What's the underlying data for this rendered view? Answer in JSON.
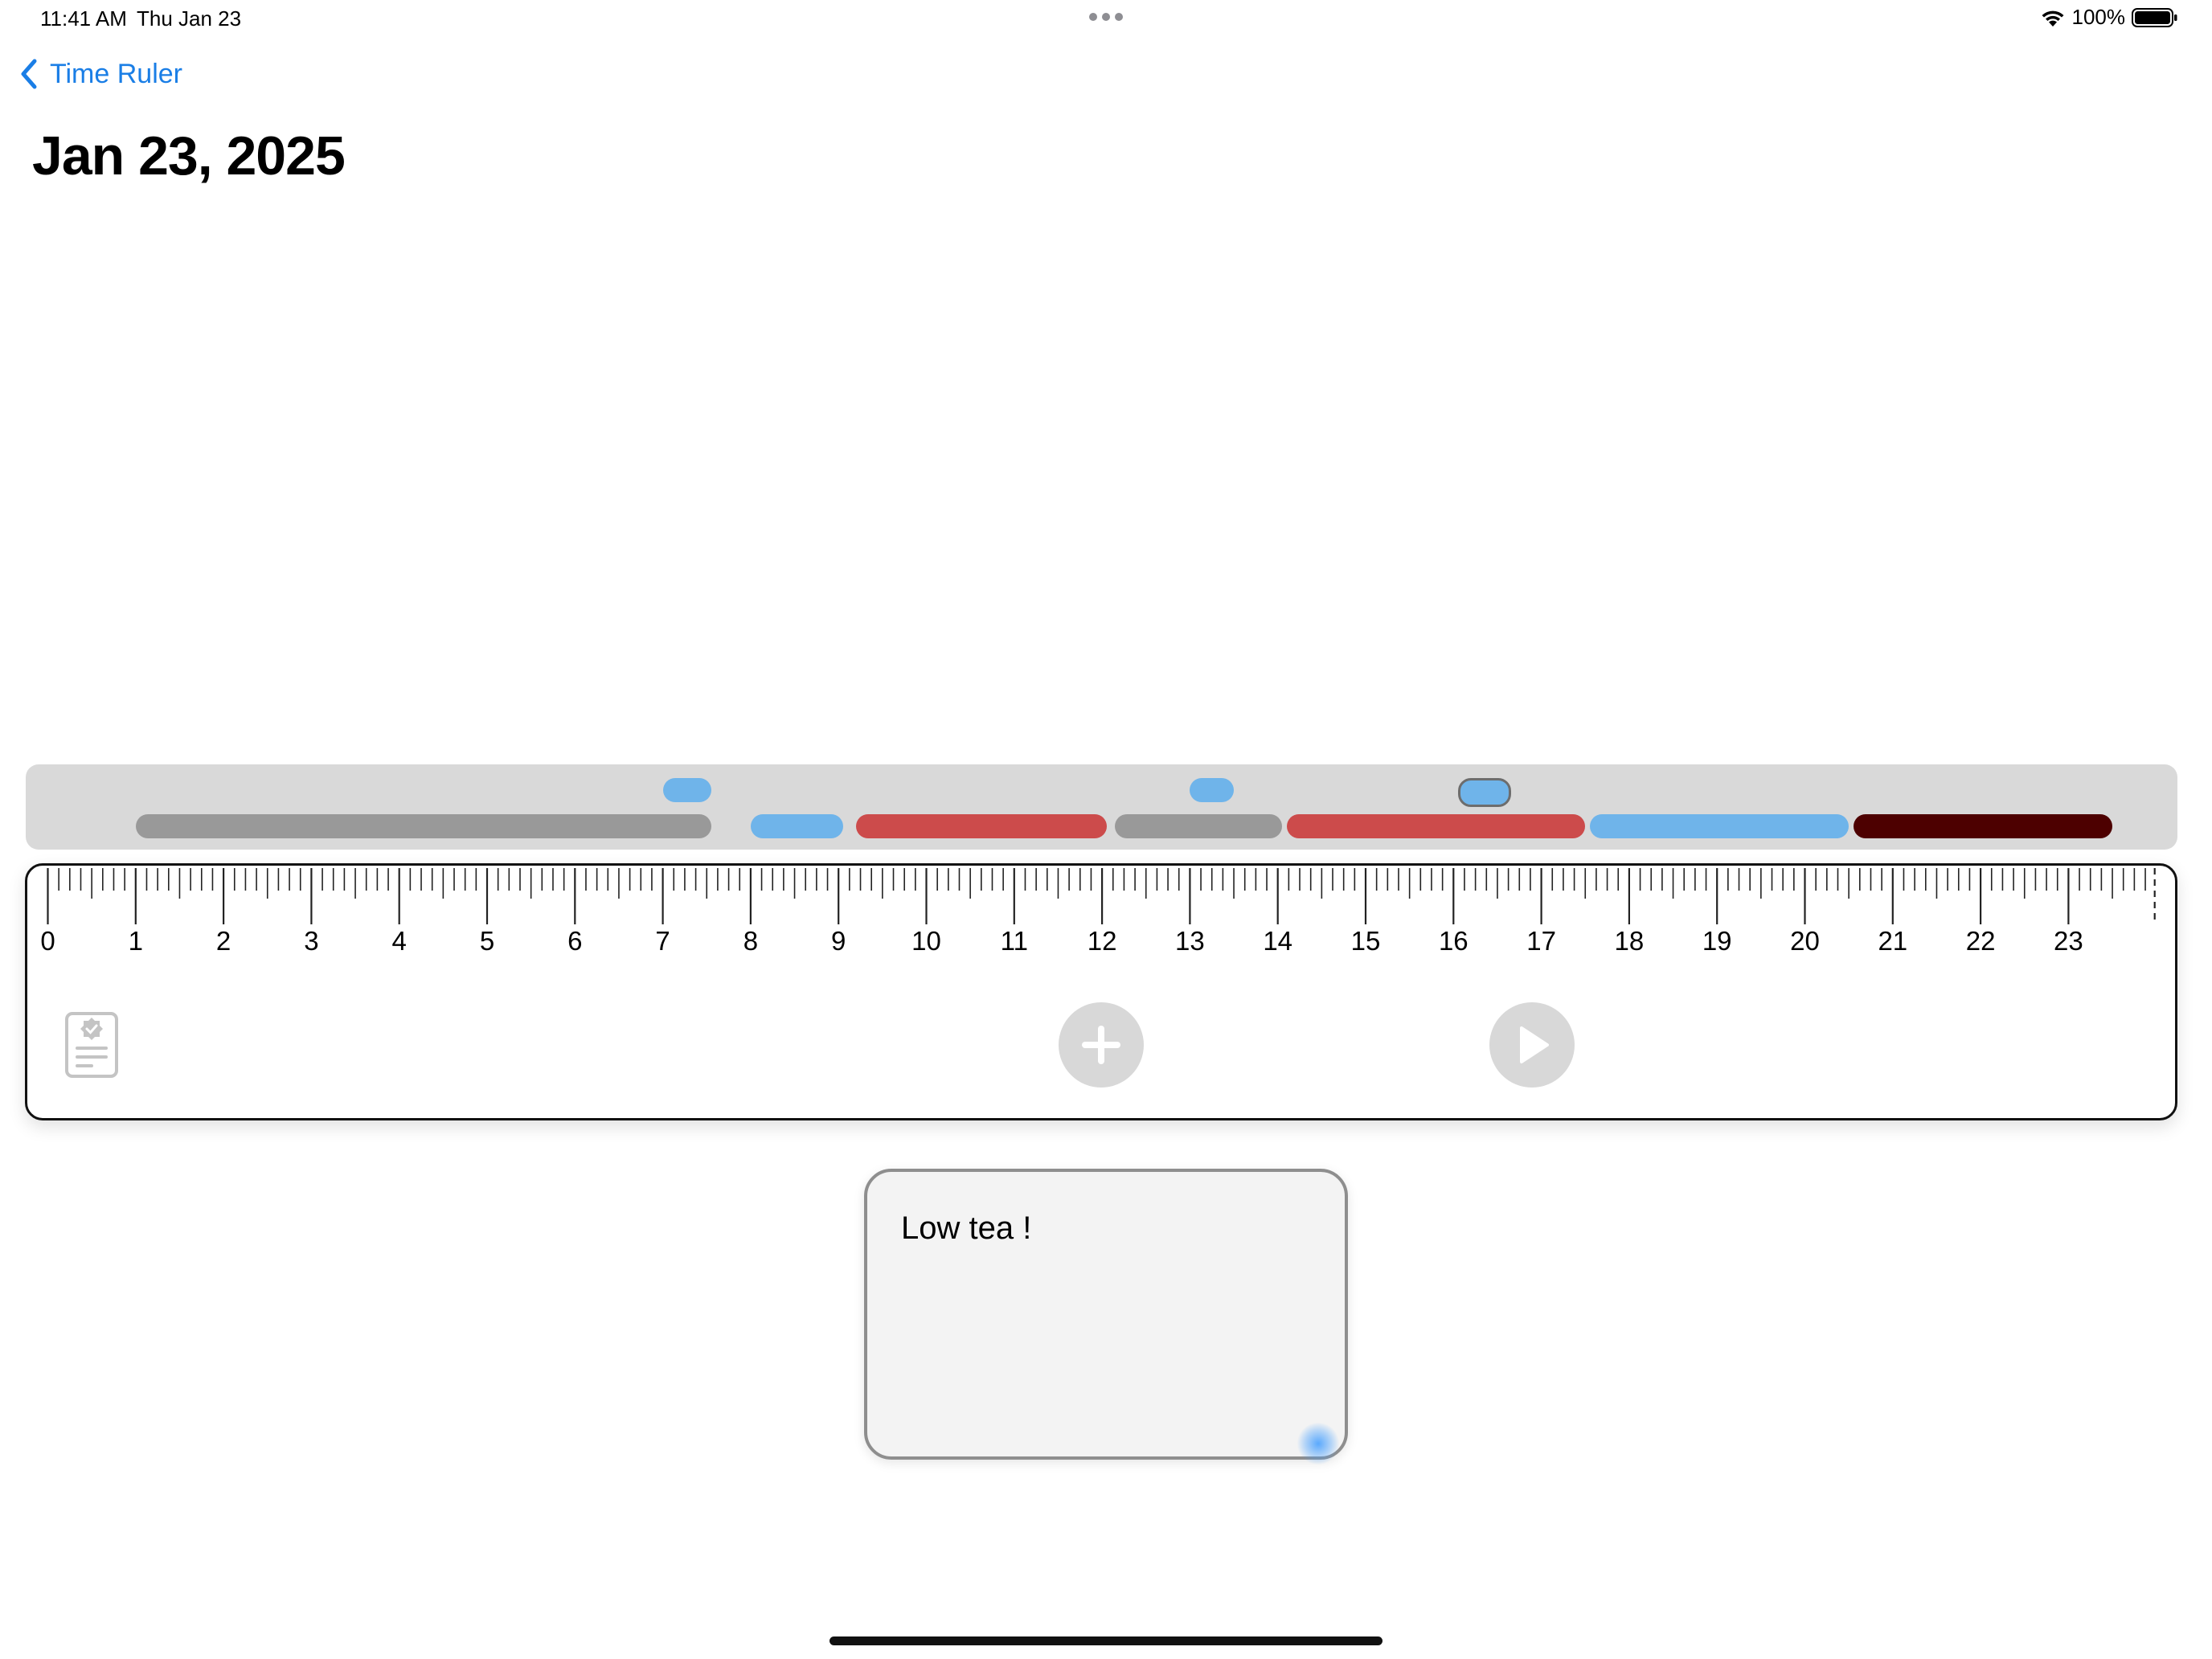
{
  "status_bar": {
    "time": "11:41 AM",
    "date": "Thu Jan 23",
    "battery": "100%"
  },
  "nav": {
    "back_label": "Time Ruler"
  },
  "page": {
    "title": "Jan 23, 2025"
  },
  "timeline": {
    "hour_labels": [
      "0",
      "1",
      "2",
      "3",
      "4",
      "5",
      "6",
      "7",
      "8",
      "9",
      "10",
      "11",
      "12",
      "13",
      "14",
      "15",
      "16",
      "17",
      "18",
      "19",
      "20",
      "21",
      "22",
      "23"
    ],
    "upper_markers": [
      {
        "start_hour": 7.0,
        "end_hour": 7.55,
        "color": "#6fb4ea"
      },
      {
        "start_hour": 13.0,
        "end_hour": 13.5,
        "color": "#6fb4ea"
      },
      {
        "start_hour": 16.05,
        "end_hour": 16.6,
        "color": "#6fb4ea",
        "selected": true
      }
    ],
    "segments": [
      {
        "start_hour": 1.0,
        "end_hour": 7.55,
        "color": "#999999"
      },
      {
        "start_hour": 8.0,
        "end_hour": 9.05,
        "color": "#6fb4ea"
      },
      {
        "start_hour": 9.2,
        "end_hour": 12.05,
        "color": "#cc4b4b"
      },
      {
        "start_hour": 12.15,
        "end_hour": 14.05,
        "color": "#999999"
      },
      {
        "start_hour": 14.1,
        "end_hour": 17.5,
        "color": "#cc4b4b"
      },
      {
        "start_hour": 17.55,
        "end_hour": 20.5,
        "color": "#6fb4ea"
      },
      {
        "start_hour": 20.55,
        "end_hour": 23.5,
        "color": "#4d0000"
      }
    ]
  },
  "toolbar": {
    "log_icon": "certificate-document-icon",
    "add_icon": "plus-icon",
    "play_icon": "play-icon"
  },
  "note": {
    "text": "Low tea !"
  }
}
